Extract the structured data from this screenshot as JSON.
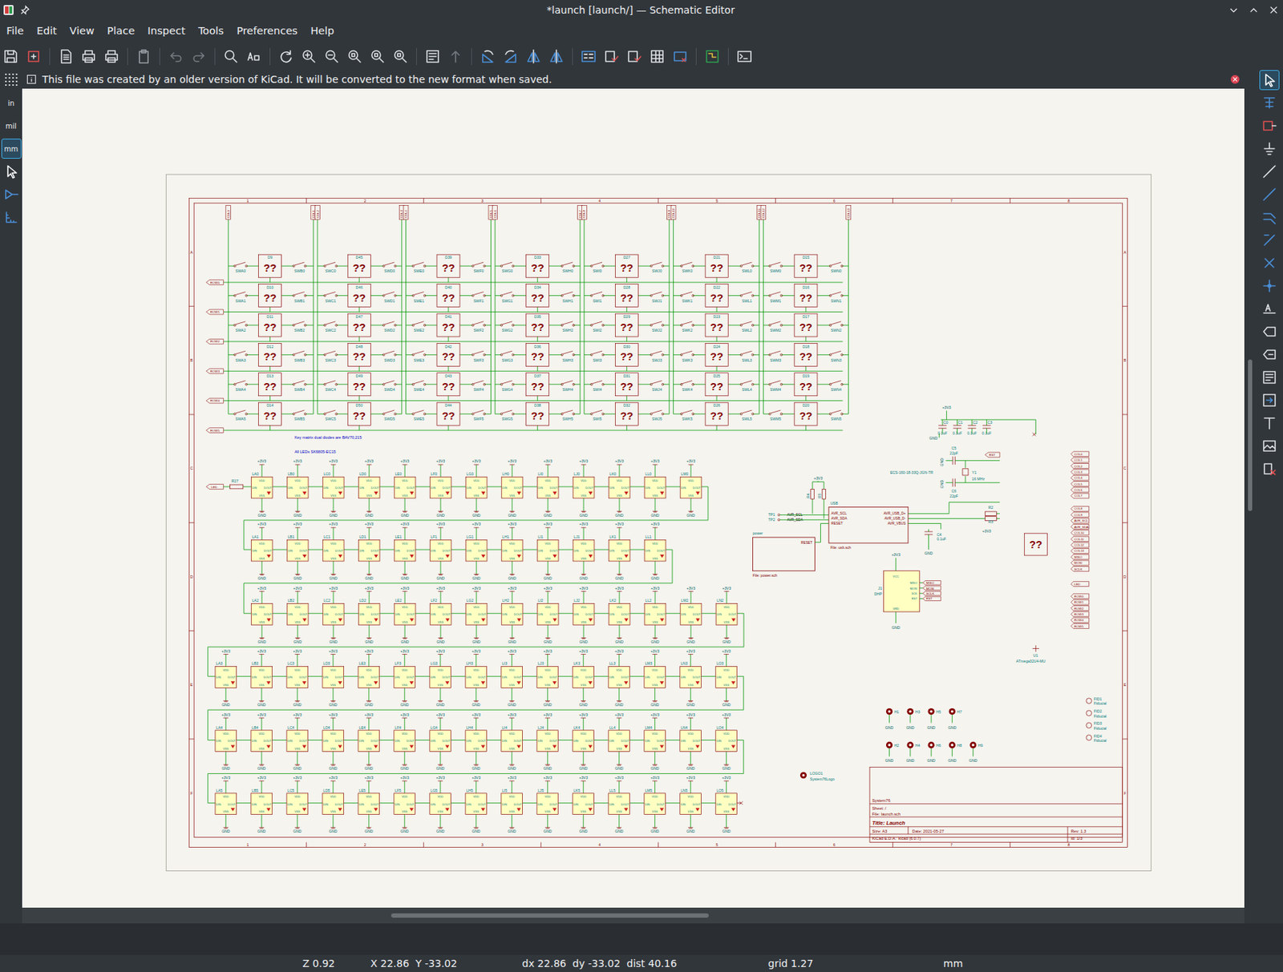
{
  "window": {
    "title": "*launch [launch/] — Schematic Editor"
  },
  "menu": [
    "File",
    "Edit",
    "View",
    "Place",
    "Inspect",
    "Tools",
    "Preferences",
    "Help"
  ],
  "infobar": {
    "message": "This file was created by an older version of KiCad. It will be converted to the new format when saved."
  },
  "units": [
    {
      "label": "in",
      "selected": false
    },
    {
      "label": "mil",
      "selected": false
    },
    {
      "label": "mm",
      "selected": true
    }
  ],
  "right_tools": [
    {
      "selected": true
    },
    {
      "selected": false
    },
    {
      "selected": false
    },
    {
      "selected": false
    },
    {
      "selected": false
    },
    {
      "selected": false
    },
    {
      "selected": false
    },
    {
      "selected": false
    },
    {
      "selected": false
    },
    {
      "selected": false
    },
    {
      "selected": false
    },
    {
      "selected": false
    },
    {
      "selected": false
    },
    {
      "selected": false
    },
    {
      "selected": false
    },
    {
      "selected": false
    },
    {
      "selected": false
    },
    {
      "selected": false
    }
  ],
  "sheet": {
    "zone_numbers": [
      "1",
      "2",
      "3",
      "4",
      "5",
      "6",
      "7",
      "8"
    ],
    "zone_letters": [
      "A",
      "B",
      "C",
      "D",
      "E",
      "F"
    ],
    "nets": {
      "power": "+3V3",
      "ground": "GND"
    },
    "columns": [
      "COL0",
      "COL1",
      "COL2",
      "COL3",
      "COL4",
      "COL5",
      "COL6",
      "COL7",
      "COL8",
      "COL9",
      "COL10",
      "COL11",
      "COL12",
      "COL13"
    ],
    "rows": [
      "ROW0",
      "ROW1",
      "ROW2",
      "ROW3",
      "ROW4",
      "ROW5"
    ],
    "switches": [
      [
        "SWA0",
        "SWB0",
        "SWC0",
        "SWD0",
        "SWE0",
        "SWF0",
        "SWG0",
        "SWH0",
        "SWI0",
        "SWJ0",
        "SWK0",
        "SWL0",
        "SWM0",
        "SWN0"
      ],
      [
        "SWA1",
        "SWB1",
        "SWC1",
        "SWD1",
        "SWE1",
        "SWF1",
        "SWG1",
        "SWH1",
        "SWI1",
        "SWJ1",
        "SWK1",
        "SWL1",
        "SWM1",
        "SWN1"
      ],
      [
        "SWA2",
        "SWB2",
        "SWC2",
        "SWD2",
        "SWE2",
        "SWF2",
        "SWG2",
        "SWH2",
        "SWI2",
        "SWJ2",
        "SWK2",
        "SWL2",
        "SWM2",
        "SWN2"
      ],
      [
        "SWA3",
        "SWB3",
        "SWC3",
        "SWD3",
        "SWE3",
        "SWF3",
        "SWG3",
        "SWH3",
        "SWI3",
        "SWJ3",
        "SWK3",
        "SWL3",
        "SWM3",
        "SWN3"
      ],
      [
        "SWA4",
        "SWB4",
        "SWC4",
        "SWD4",
        "SWE4",
        "SWF4",
        "SWG4",
        "SWH4",
        "SWI4",
        "SWJ4",
        "SWK4",
        "SWL4",
        "SWM4",
        "SWN4"
      ],
      [
        "SWA5",
        "SWB5",
        "SWC5",
        "SWD5",
        "SWE5",
        "SWF5",
        "SWG5",
        "SWH5",
        "SWI5",
        "SWJ5",
        "SWK5",
        "SWL5",
        "SWM5",
        "SWN5"
      ]
    ],
    "diodes": [
      [
        "D9",
        "D45",
        "D39",
        "D33",
        "D27",
        "D21",
        "D15"
      ],
      [
        "D10",
        "D46",
        "D40",
        "D34",
        "D28",
        "D22",
        "D16"
      ],
      [
        "D11",
        "D47",
        "D41",
        "D35",
        "D29",
        "D23",
        "D17"
      ],
      [
        "D12",
        "D48",
        "D42",
        "D36",
        "D30",
        "D24",
        "D18"
      ],
      [
        "D13",
        "D49",
        "D43",
        "D37",
        "D31",
        "D25",
        "D19"
      ],
      [
        "D14",
        "D50",
        "D44",
        "D38",
        "D32",
        "D26",
        "D20"
      ]
    ],
    "unknown_symbol": "??",
    "notes": [
      "Key matrix dual diodes are BAV70,215",
      "All LEDs SK6805-EC15"
    ],
    "led_chain": {
      "input": "LED",
      "resistor": "R27"
    },
    "led_pins": {
      "din": "DIN",
      "dout": "DOUT",
      "vdd": "VDD",
      "vss": "VSS"
    },
    "leds": [
      [
        "LA0",
        "LB0",
        "LC0",
        "LD0",
        "LE0",
        "LF0",
        "LG0",
        "LH0",
        "LI0",
        "LJ0",
        "LK0",
        "LL0",
        "LM0"
      ],
      [
        "LA1",
        "LB1",
        "LC1",
        "LD1",
        "LE1",
        "LF1",
        "LG1",
        "LH1",
        "LI1",
        "LJ1",
        "LK1",
        "LL1"
      ],
      [
        "LA2",
        "LB2",
        "LC2",
        "LD2",
        "LE2",
        "LF2",
        "LG2",
        "LH2",
        "LI2",
        "LJ2",
        "LK2",
        "LL2",
        "LM2",
        "LN2"
      ],
      [
        "LA3",
        "LB3",
        "LC3",
        "LD3",
        "LE3",
        "LF3",
        "LG3",
        "LH3",
        "LI3",
        "LJ3",
        "LK3",
        "LL3",
        "LM3",
        "LN3",
        "LO3"
      ],
      [
        "LA4",
        "LB4",
        "LC4",
        "LD4",
        "LE4",
        "LF4",
        "LG4",
        "LH4",
        "LI4",
        "LJ4",
        "LK4",
        "LL4",
        "LM4",
        "LN4",
        "LO4"
      ],
      [
        "LA5",
        "LB5",
        "LC5",
        "LD5",
        "LE5",
        "LF5",
        "LG5",
        "LH5",
        "LI5",
        "LJ5",
        "LK5",
        "LL5",
        "LM5",
        "LN5",
        "LO5"
      ]
    ],
    "decoupling": [
      {
        "ref": "C0",
        "value": "0.1uF"
      },
      {
        "ref": "C1",
        "value": "0.1uF"
      },
      {
        "ref": "C2",
        "value": "0.1uF"
      },
      {
        "ref": "C3",
        "value": "0.1uF"
      }
    ],
    "crystal": {
      "ref": "Y1",
      "value": "16 MHz",
      "part": "ECS-160-18-33Q-JGN-TR",
      "caps": [
        {
          "ref": "C5",
          "value": "22pF"
        },
        {
          "ref": "C6",
          "value": "22pF"
        }
      ],
      "reset": "RST"
    },
    "usb_sheet": {
      "name": "USB",
      "file": "File: usb.sch",
      "left_pins": [
        "AVR_SCL",
        "AVR_SDA",
        "RESET"
      ],
      "right_pins": [
        "AVR_USB_D+",
        "AVR_USB_D-",
        "AVR_VBUS"
      ]
    },
    "test_points": [
      {
        "ref": "TP1",
        "net": "AVR_SCL"
      },
      {
        "ref": "TP2",
        "net": "AVR_SDA"
      }
    ],
    "pullups": [
      "R4",
      "R5"
    ],
    "series_resistors": [
      "R2",
      "R3"
    ],
    "c4": {
      "ref": "C4",
      "value": "0.1uF"
    },
    "power_sheet": {
      "name": "power",
      "file": "File: power.sch",
      "pin": "RESET"
    },
    "header": {
      "ref": "J1",
      "value": "DHP",
      "vcc": "VCC",
      "gnd": "GND",
      "pins": [
        "MISO",
        "MOSI",
        "SCK",
        "RST"
      ],
      "labels": [
        "MISO",
        "MOSI",
        "SCLK",
        "RST"
      ]
    },
    "mcu": {
      "ref": "U1",
      "value": "ATmega32U4-MU"
    },
    "global_labels": [
      [
        "COL0",
        "COL1",
        "COL2",
        "COL3",
        "COL4",
        "COL5",
        "COL6",
        "COL7"
      ],
      [
        "COL8",
        "COL9",
        "AVR_SCL",
        "AVR_SDA",
        "COL10"
      ],
      [
        "COL11",
        "COL12",
        "COL13",
        "MISO",
        "MOSI",
        "SCLK"
      ],
      [
        "LED"
      ],
      [
        "ROW0",
        "ROW1",
        "ROW2",
        "ROW3",
        "ROW4",
        "ROW5"
      ]
    ],
    "mounting_holes": {
      "top": [
        "H1",
        "H3",
        "H5",
        "H7"
      ],
      "bottom": [
        "H2",
        "H4",
        "H6",
        "H8",
        "H9"
      ]
    },
    "fiducials": [
      {
        "ref": "FID1",
        "value": "Fiducial"
      },
      {
        "ref": "FID2",
        "value": "Fiducial"
      },
      {
        "ref": "FID3",
        "value": "Fiducial"
      },
      {
        "ref": "FID4",
        "value": "Fiducial"
      }
    ],
    "logo": {
      "ref": "LOGO1",
      "value": "System76Logo"
    },
    "title_block": {
      "company": "System76",
      "sheet": "Sheet: /",
      "file": "File: launch.sch",
      "title": "Title: Launch",
      "size": "Size: A3",
      "date": "Date: 2021-05-27",
      "rev": "Rev: 1.3",
      "tool": "KiCad E.D.A.  kicad (6.0.7)",
      "id": "Id: 1/3"
    }
  },
  "status_bar": {
    "zoom": "Z 0.92",
    "cursor": "X 22.86  Y -33.02",
    "delta": "dx 22.86  dy -33.02  dist 40.16",
    "grid": "grid 1.27",
    "units": "mm"
  }
}
